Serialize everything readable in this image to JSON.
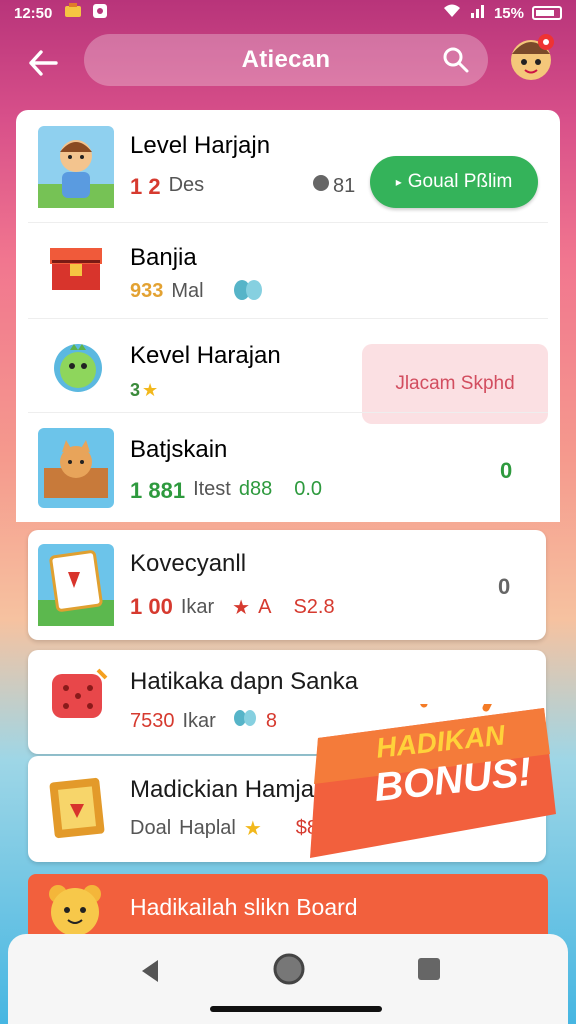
{
  "status_bar": {
    "time": "12:50",
    "battery": "15%"
  },
  "header": {
    "title": "Atiecan"
  },
  "items": [
    {
      "title": "Level Harjajn",
      "count": "1 2",
      "unit": "Des",
      "extra": "81"
    },
    {
      "title": "Banjia",
      "count": "933",
      "unit": "Mal"
    },
    {
      "title": "Kevel Harajan",
      "count": "3"
    },
    {
      "title": "Batjskain",
      "count": "1 881",
      "unit": "Itest",
      "extra": "d88",
      "extra2": "0.0",
      "side": "0"
    },
    {
      "title": "Kovecyanll",
      "count": "1 00",
      "unit": "Ikar",
      "extra": "A",
      "extra2": "S2.8",
      "side": "0"
    },
    {
      "title": "Hatikaka dapn Sanka",
      "count": "7530",
      "unit": "Ikar",
      "extra": "8"
    },
    {
      "title": "Madickian Hamjan",
      "count": "Doal",
      "unit": "Haplal",
      "extra": "$890"
    }
  ],
  "buttons": {
    "green": "Goual Pßlim",
    "pink": "Jlacam Skphd"
  },
  "bonus": {
    "line1": "HADIKAN",
    "line2": "BONUS!"
  },
  "banner": {
    "text": "Hadikailah slikn Board"
  },
  "colors": {
    "accent_green": "#34b35a",
    "accent_pink": "#d24d5f",
    "banner": "#f2603d",
    "header": "#b8347a"
  }
}
